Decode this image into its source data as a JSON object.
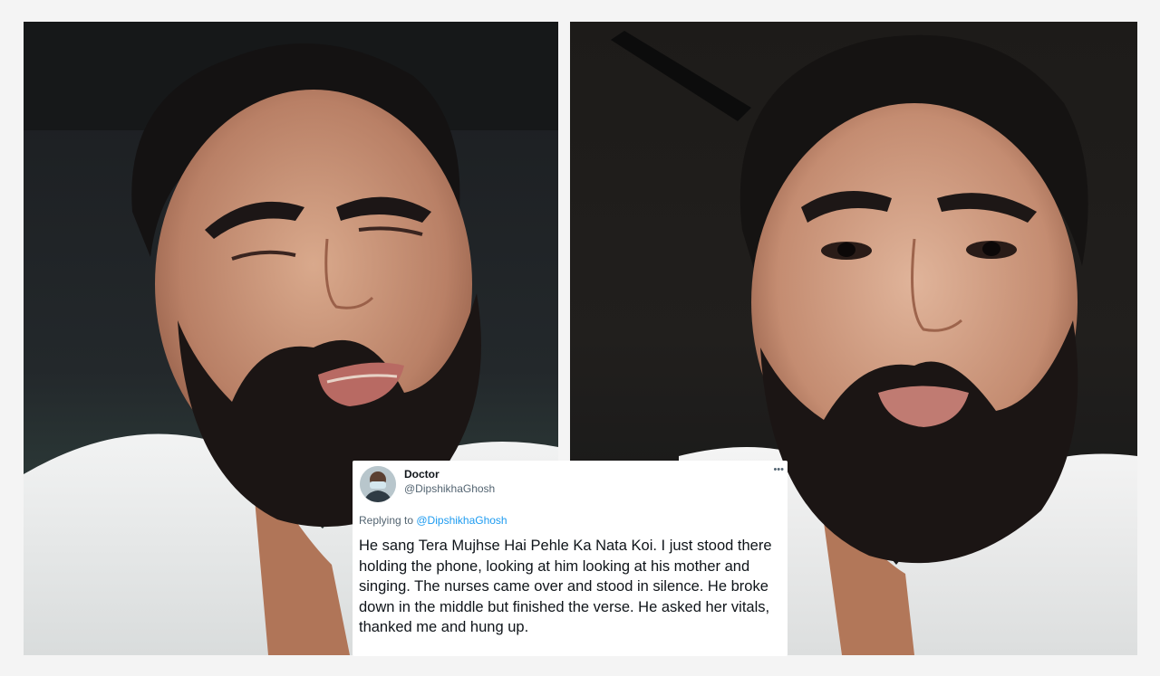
{
  "tweet": {
    "display_name": "Doctor",
    "handle": "@DipshikhaGhosh",
    "more_icon": "ellipsis-icon",
    "replying_prefix": "Replying to ",
    "replying_to": "@DipshikhaGhosh",
    "text": "He sang Tera Mujhse Hai Pehle Ka Nata Koi. I just stood there holding the phone, looking at him looking at his mother and singing. The nurses came over and stood in silence. He broke down in the middle but finished the verse. He asked her vitals, thanked me and hung up."
  },
  "colors": {
    "background": "#f4f4f4",
    "tweet_background": "#ffffff",
    "link_blue": "#1d9bf0",
    "muted_text": "#536471"
  }
}
